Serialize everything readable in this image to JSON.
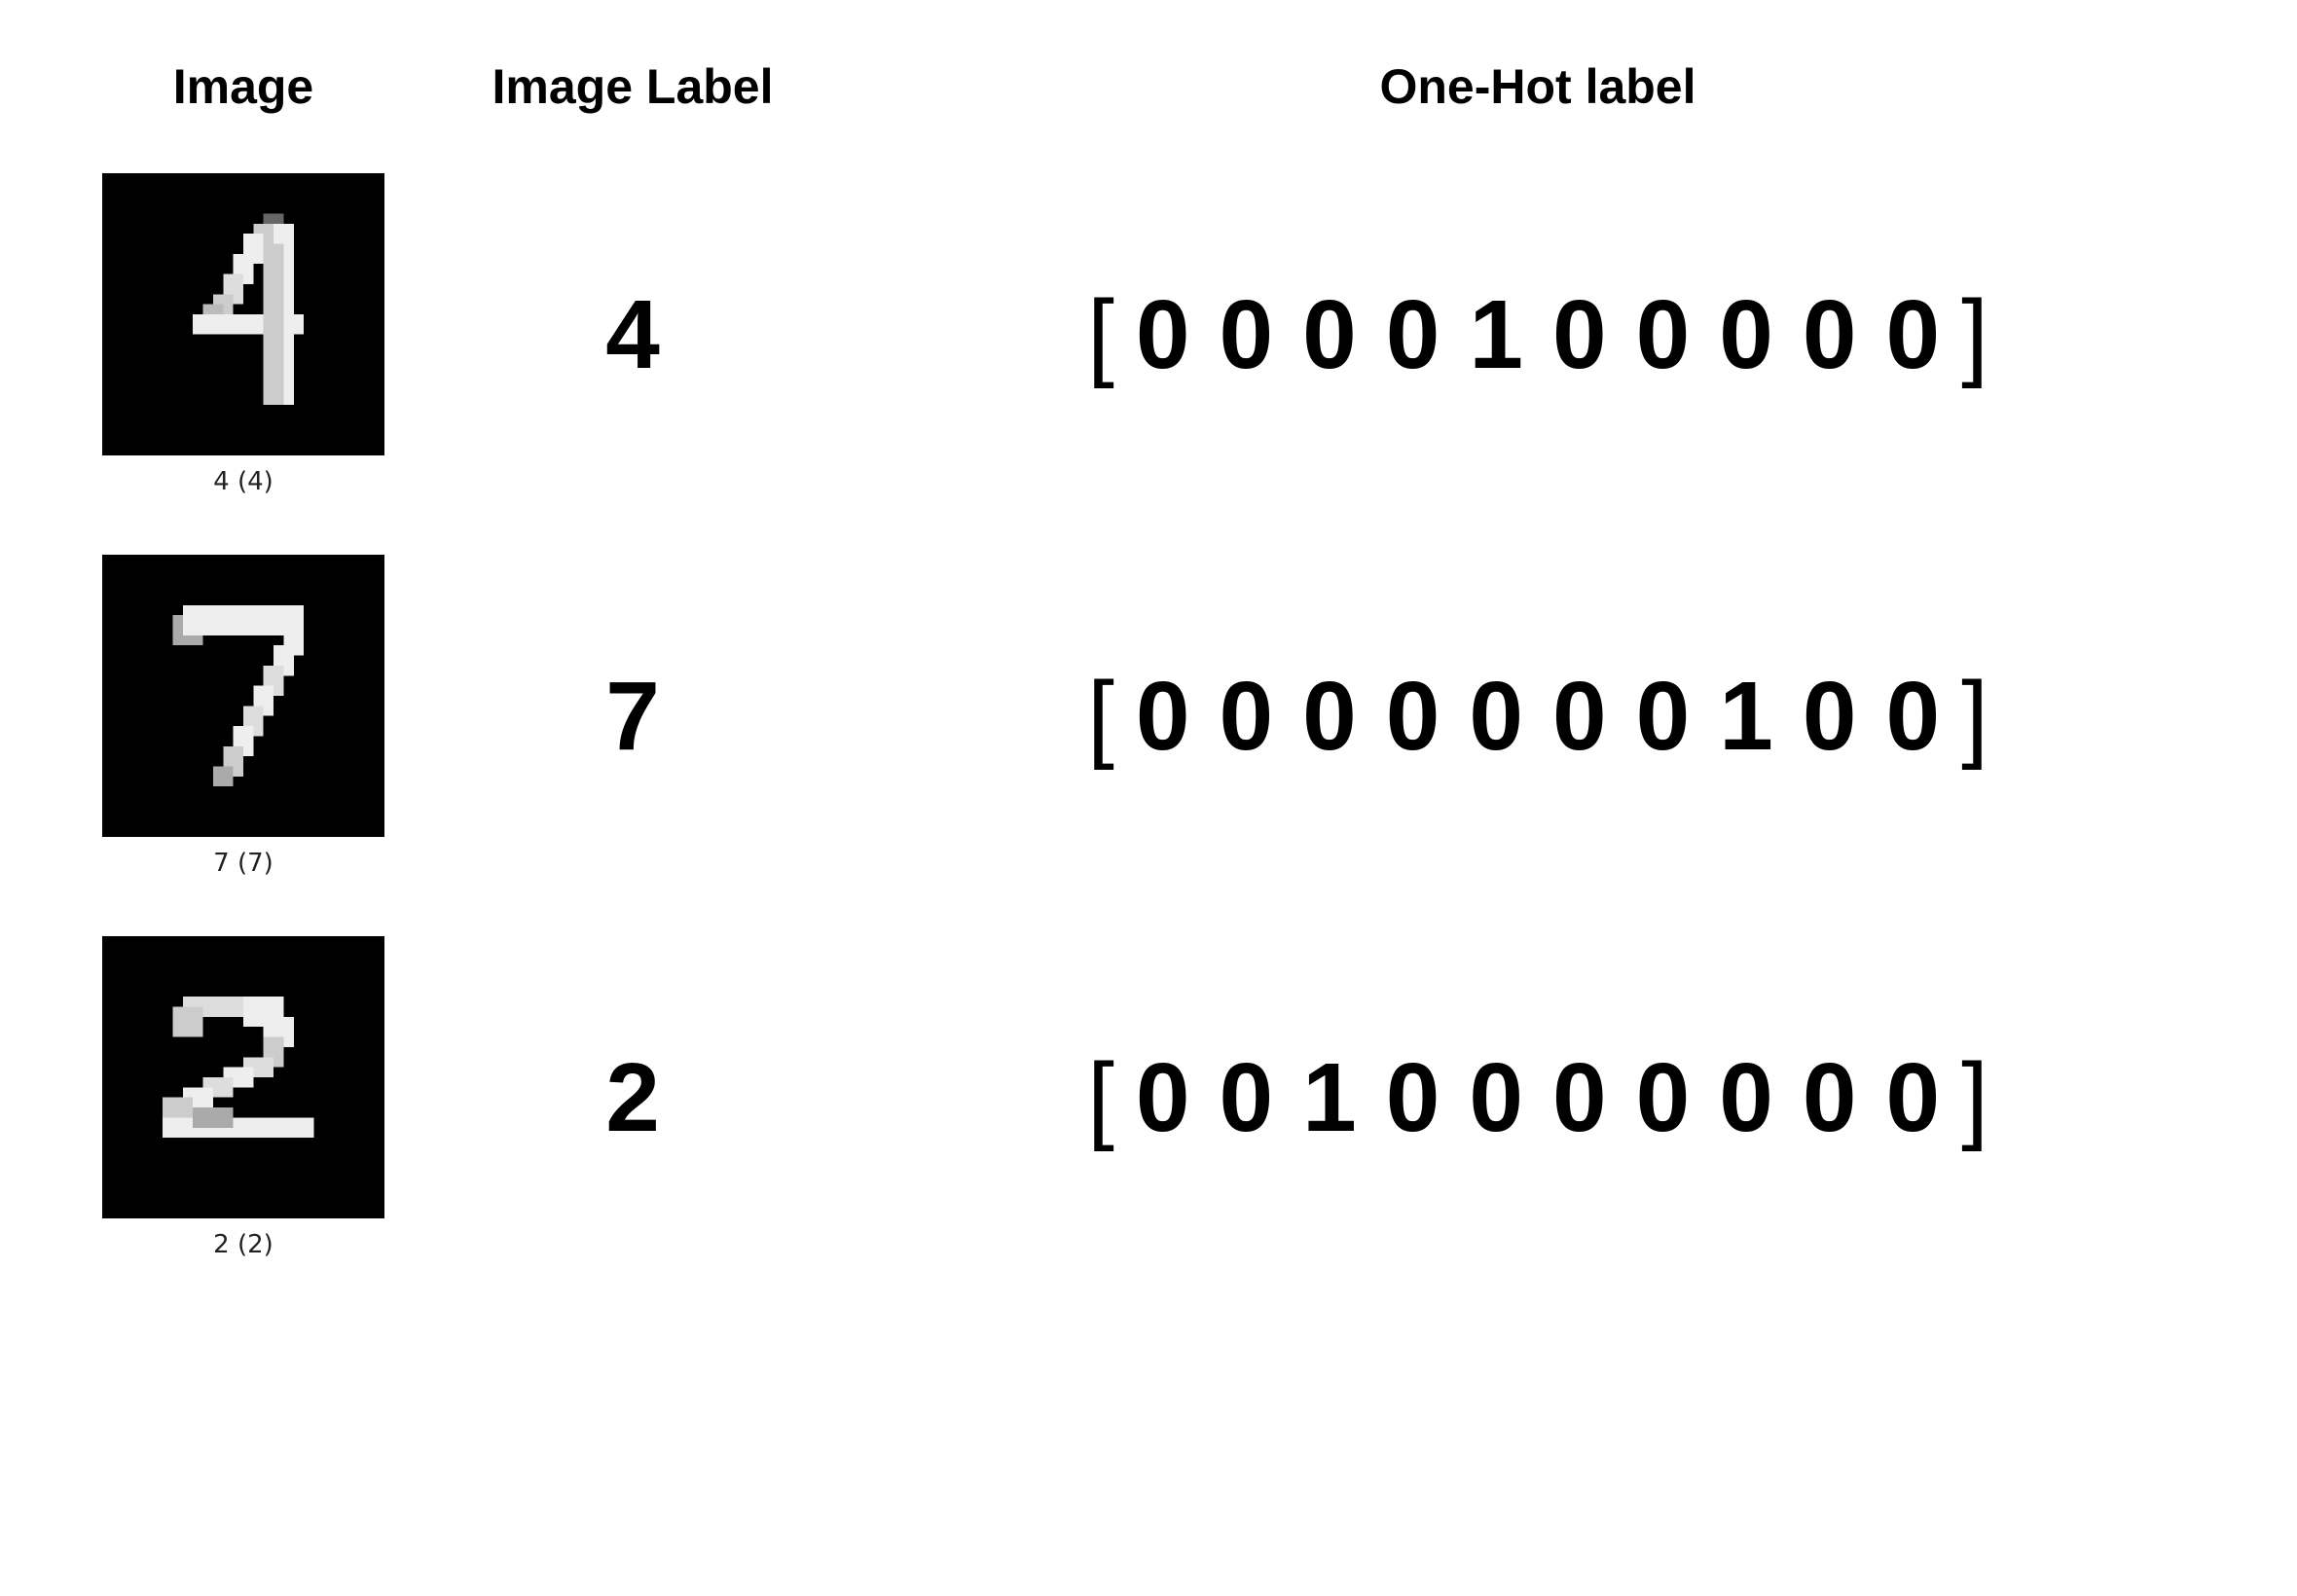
{
  "headers": {
    "image": "Image",
    "label": "Image Label",
    "onehot": "One-Hot label"
  },
  "rows": [
    {
      "caption": "4 (4)",
      "digit_svg": "four",
      "label": "4",
      "onehot": [
        "0",
        "0",
        "0",
        "0",
        "1",
        "0",
        "0",
        "0",
        "0",
        "0"
      ]
    },
    {
      "caption": "7 (7)",
      "digit_svg": "seven",
      "label": "7",
      "onehot": [
        "0",
        "0",
        "0",
        "0",
        "0",
        "0",
        "0",
        "1",
        "0",
        "0"
      ]
    },
    {
      "caption": "2 (2)",
      "digit_svg": "two",
      "label": "2",
      "onehot": [
        "0",
        "0",
        "1",
        "0",
        "0",
        "0",
        "0",
        "0",
        "0",
        "0"
      ]
    }
  ],
  "brackets": {
    "open": "[",
    "close": "]"
  }
}
